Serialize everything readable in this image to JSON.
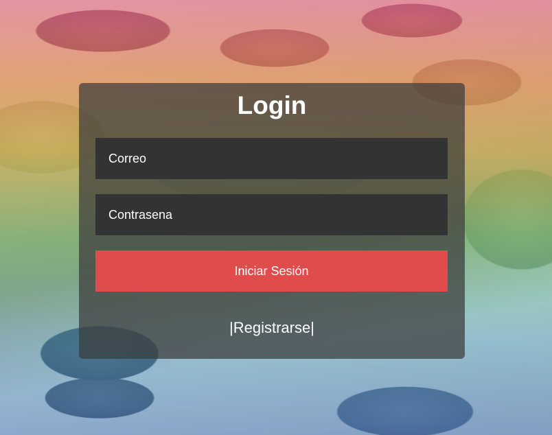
{
  "login": {
    "title": "Login",
    "email_placeholder": "Correo",
    "password_placeholder": "Contrasena",
    "submit_label": "Iniciar Sesión",
    "register_link": "|Registrarse|"
  },
  "colors": {
    "button_accent": "#e04b4b",
    "input_background": "#333333",
    "panel_background": "rgba(60,60,60,0.72)"
  }
}
